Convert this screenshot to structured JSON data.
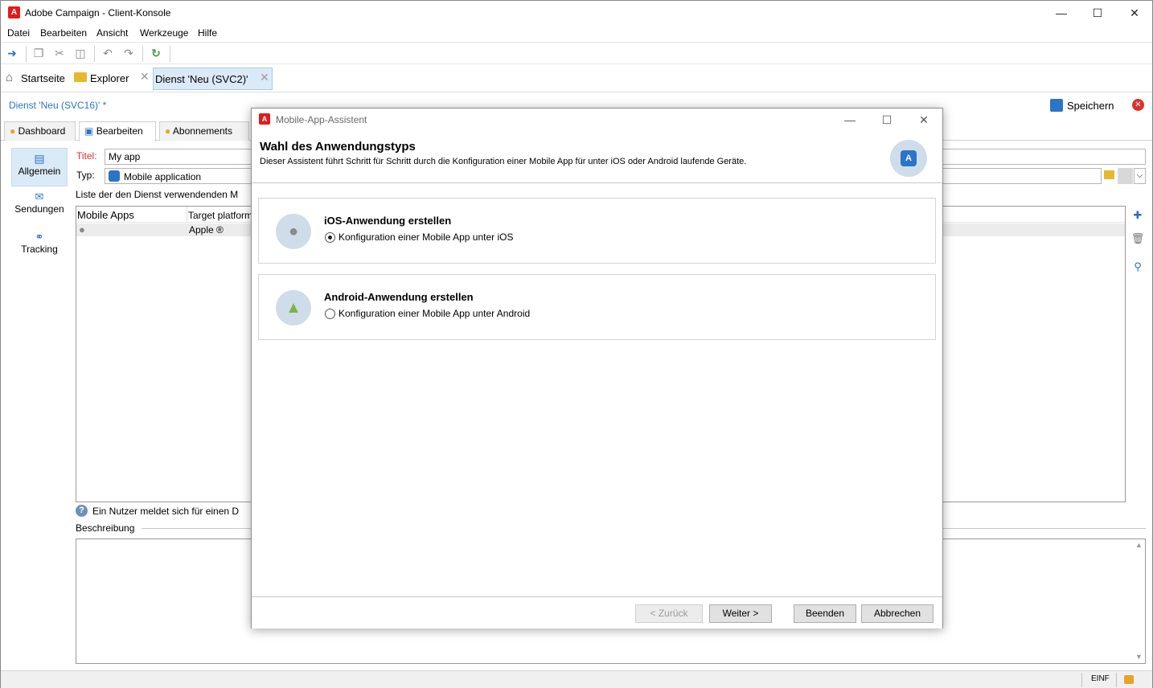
{
  "app": {
    "title": "Adobe Campaign - Client-Konsole",
    "logo_letter": "A"
  },
  "menu": [
    "Datei",
    "Bearbeiten",
    "Ansicht",
    "Werkzeuge",
    "Hilfe"
  ],
  "nav": {
    "home": "Startseite",
    "explorer": "Explorer",
    "active_tab": "Dienst 'Neu (SVC2)'"
  },
  "editor": {
    "doc_title": "Dienst 'Neu (SVC16)' *",
    "save_label": "Speichern",
    "tabs": [
      "Dashboard",
      "Bearbeiten",
      "Abonnements"
    ],
    "sidebar": [
      "Allgemein",
      "Sendungen",
      "Tracking"
    ],
    "title_label": "Titel:",
    "title_value": "My app",
    "type_label": "Typ:",
    "type_value": "Mobile application",
    "list_label": "Liste der den Dienst verwendenden M",
    "grid_headers": [
      "Mobile Apps",
      "Target platform"
    ],
    "grid_row": {
      "platform": "Apple ®"
    },
    "hint": "Ein Nutzer meldet sich für einen D",
    "description_label": "Beschreibung"
  },
  "status": {
    "lang": "EINF"
  },
  "dialog": {
    "window_title": "Mobile-App-Assistent",
    "heading": "Wahl des Anwendungstyps",
    "subheading": "Dieser Assistent führt Schritt für Schritt durch die Konfiguration einer Mobile App für unter iOS oder Android laufende Geräte.",
    "ios": {
      "title": "iOS-Anwendung erstellen",
      "radio": "Konfiguration einer Mobile App unter iOS",
      "selected": true
    },
    "android": {
      "title": "Android-Anwendung erstellen",
      "radio": "Konfiguration einer Mobile App unter Android",
      "selected": false
    },
    "buttons": {
      "back": "< Zurück",
      "next": "Weiter >",
      "finish": "Beenden",
      "cancel": "Abbrechen"
    }
  },
  "colors": {
    "accent": "#2b74c8",
    "brand": "#e21b1b",
    "android": "#7cb342"
  }
}
